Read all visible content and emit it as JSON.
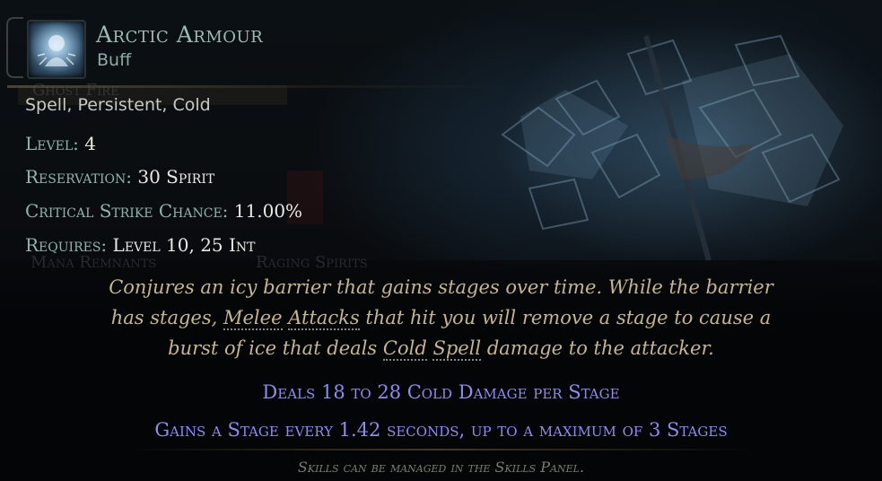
{
  "skill": {
    "name": "Arctic Armour",
    "type": "Buff",
    "tags": "Spell, Persistent, Cold",
    "icon": "arctic-armour-icon"
  },
  "stats": {
    "level_label": "Level:",
    "level_value": "4",
    "reservation_label": "Reservation:",
    "reservation_value": "30 Spirit",
    "crit_label": "Critical Strike Chance:",
    "crit_value": "11.00%",
    "requires_label": "Requires:",
    "requires_value": "Level 10, 25 Int"
  },
  "description": {
    "line1": "Conjures an icy barrier that gains stages over time. While the barrier",
    "line2_pre": "has stages,",
    "line2_kw1": "Melee",
    "line2_kw2": "Attacks",
    "line2_post": "that hit you will remove a stage to cause a",
    "line3_pre": "burst of ice that deals",
    "line3_kw1": "Cold",
    "line3_kw2": "Spell",
    "line3_post": "damage to the attacker."
  },
  "mods": [
    "Deals 18 to 28 Cold Damage per Stage",
    "Gains a Stage every 1.42 seconds, up to a maximum of 3 Stages"
  ],
  "footer": "Skills can be managed in the Skills Panel.",
  "background_text": {
    "ghost1": "Mana Remnants",
    "ghost2": "Raging Spirits",
    "ghost3": "Ghost Fire"
  },
  "colors": {
    "name": "#9fb9b2",
    "stat_label": "#8fb4ae",
    "description": "#c6b58f",
    "mod": "#8d8cf0"
  }
}
